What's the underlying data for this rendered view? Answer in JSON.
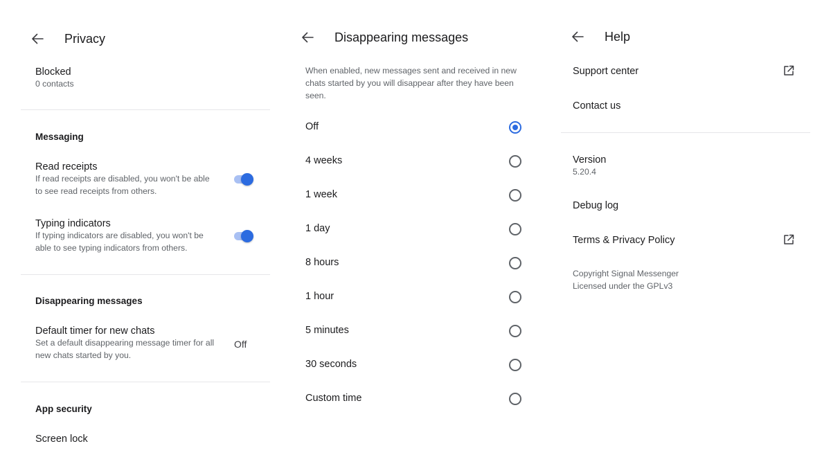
{
  "privacy": {
    "title": "Privacy",
    "blocked": {
      "title": "Blocked",
      "summary": "0 contacts"
    },
    "messaging": {
      "header": "Messaging",
      "read_receipts": {
        "title": "Read receipts",
        "summary": "If read receipts are disabled, you won't be able to see read receipts from others.",
        "enabled": true
      },
      "typing_indicators": {
        "title": "Typing indicators",
        "summary": "If typing indicators are disabled, you won't be able to see typing indicators from others.",
        "enabled": true
      }
    },
    "disappearing": {
      "header": "Disappearing messages",
      "default_timer": {
        "title": "Default timer for new chats",
        "summary": "Set a default disappearing message timer for all new chats started by you.",
        "value": "Off"
      }
    },
    "app_security": {
      "header": "App security",
      "screen_lock": "Screen lock"
    }
  },
  "disappearing_messages": {
    "title": "Disappearing messages",
    "description": "When enabled, new messages sent and received in new chats started by you will disappear after they have been seen.",
    "options": [
      {
        "label": "Off",
        "selected": true
      },
      {
        "label": "4 weeks",
        "selected": false
      },
      {
        "label": "1 week",
        "selected": false
      },
      {
        "label": "1 day",
        "selected": false
      },
      {
        "label": "8 hours",
        "selected": false
      },
      {
        "label": "1 hour",
        "selected": false
      },
      {
        "label": "5 minutes",
        "selected": false
      },
      {
        "label": "30 seconds",
        "selected": false
      },
      {
        "label": "Custom time",
        "selected": false
      }
    ]
  },
  "help": {
    "title": "Help",
    "support_center": "Support center",
    "contact_us": "Contact us",
    "version": {
      "title": "Version",
      "value": "5.20.4"
    },
    "debug_log": "Debug log",
    "terms": "Terms & Privacy Policy",
    "copyright": "Copyright Signal Messenger",
    "license": "Licensed under the GPLv3"
  },
  "colors": {
    "accent": "#2c6be0",
    "accent_track": "#a9c0f3",
    "divider": "#e6e6e9",
    "secondary_text": "#5f6368"
  },
  "icons": {
    "back": "arrow-left-icon",
    "external": "external-link-icon"
  }
}
